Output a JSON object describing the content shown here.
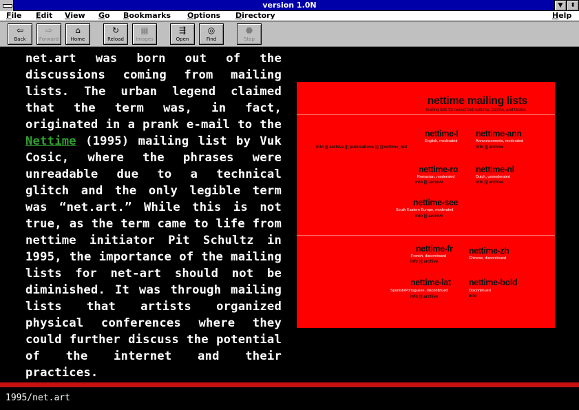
{
  "window": {
    "title": "version 1.0N"
  },
  "menu": [
    "File",
    "Edit",
    "View",
    "Go",
    "Bookmarks",
    "Options",
    "Directory",
    "Help"
  ],
  "toolbar": [
    {
      "label": "Back",
      "icon": "back-arrow-icon",
      "glyph": "⇦",
      "enabled": true
    },
    {
      "label": "Forward",
      "icon": "forward-arrow-icon",
      "glyph": "⇨",
      "enabled": false
    },
    {
      "label": "Home",
      "icon": "home-icon",
      "glyph": "⌂",
      "enabled": true
    },
    {
      "label": "Reload",
      "icon": "reload-icon",
      "glyph": "↻",
      "enabled": true
    },
    {
      "label": "Images",
      "icon": "images-icon",
      "glyph": "▦",
      "enabled": false
    },
    {
      "label": "Open",
      "icon": "open-icon",
      "glyph": "⇶",
      "enabled": true
    },
    {
      "label": "Find",
      "icon": "find-binoculars-icon",
      "glyph": "◎",
      "enabled": true
    },
    {
      "label": "Stop",
      "icon": "stop-icon",
      "glyph": "⬣",
      "enabled": false
    }
  ],
  "article": {
    "before_link": "net.art was born out of the discussions coming from mailing lists. The urban legend claimed that the term was, in fact, originated in a prank e-mail to the ",
    "link_text": "Nettime",
    "after_link": " (1995) mailing list by Vuk Cosic, where the phrases were unreadable due to a technical glitch and the only legible term was “net.art.” While this is not true, as the term came to life from nettime initiator Pit Schultz in 1995, the importance of the mailing lists for net-art should not be diminished. It was through mailing lists that artists organized physical conferences where they could further discuss the potential of the internet and their practices."
  },
  "panel": {
    "title": "nettime mailing lists",
    "subtitle": "mailing lists for networked cultures, politics, and tactics",
    "lists": [
      {
        "name": "nettime-l",
        "desc": "English, moderated",
        "links": "info  |||  archive  |||  publications  |||  @nettime_bot"
      },
      {
        "name": "nettime-ann",
        "desc": "Announcements, moderated",
        "links": "info  |||  archive"
      },
      {
        "name": "nettime-ro",
        "desc": "Romanian, moderated",
        "links": "info  |||  archive"
      },
      {
        "name": "nettime-nl",
        "desc": "Dutch, unmoderated",
        "links": "info  |||  archive"
      },
      {
        "name": "nettime-see",
        "desc": "South Eastern Europe, moderated",
        "links": "info  |||  archive"
      },
      {
        "name": "nettime-fr",
        "desc": "French, discontinued",
        "links": "info  |||  archive"
      },
      {
        "name": "nettime-zh",
        "desc": "Chinese, discontinued",
        "links": ""
      },
      {
        "name": "nettime-lat",
        "desc": "Spanish/Portuguese, discontinued",
        "links": "info  |||  archive"
      },
      {
        "name": "nettime-bold",
        "desc": "Discontinued",
        "links": "info"
      }
    ]
  },
  "caption": "1995/net.art",
  "colors": {
    "titlebar": "#0000a8",
    "panel": "#ff0000",
    "link": "#2ea02e",
    "rule": "#c81010"
  }
}
